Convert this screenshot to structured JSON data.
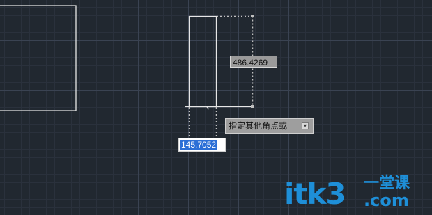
{
  "drawing": {
    "dimension_value": "486.4269",
    "command_prompt": "指定其他角点或",
    "prompt_arrow_icon": "down-arrow-icon",
    "input_value": "145.7052"
  },
  "watermark": {
    "main": "itk3",
    "sub": "一堂课",
    "domain": ".com",
    "color": "#1e8fd8"
  },
  "colors": {
    "background": "#212830",
    "line": "#e6e6e6",
    "selection": "#2b6fd6"
  }
}
